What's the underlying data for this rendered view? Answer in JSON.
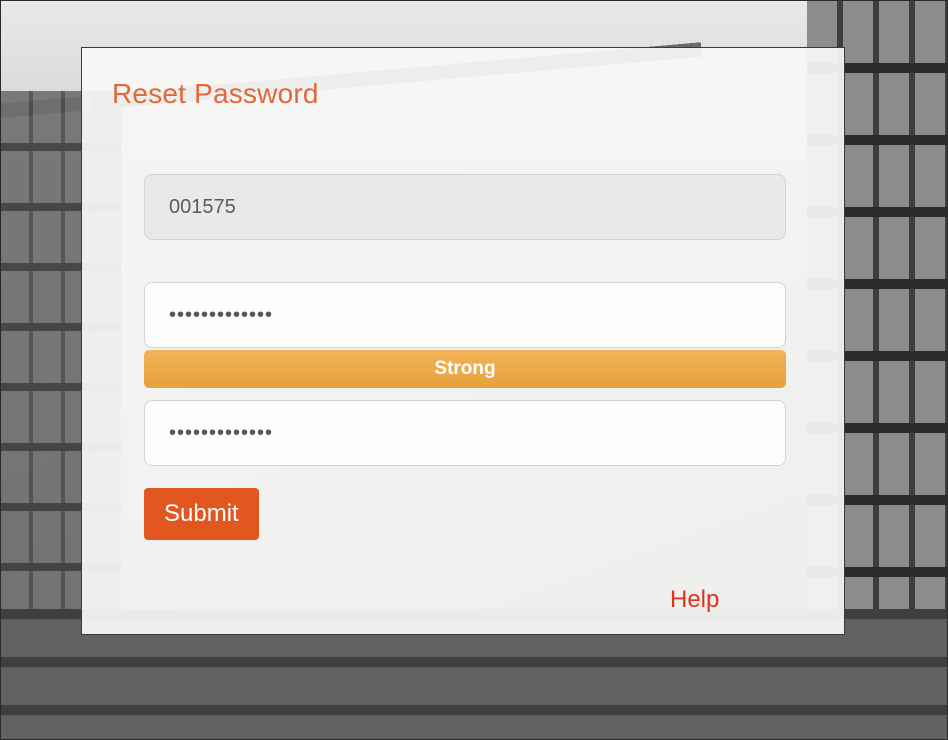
{
  "page": {
    "title": "Reset Password"
  },
  "form": {
    "user_id": {
      "value": "001575"
    },
    "new_password": {
      "value": "•••••••••••••"
    },
    "password_strength": {
      "label": "Strong"
    },
    "confirm_password": {
      "value": "•••••••••••••"
    },
    "submit_label": "Submit"
  },
  "footer": {
    "help_label": "Help"
  },
  "colors": {
    "accent": "#e2673a",
    "button": "#e2571f",
    "strength_strong": "#e6a13c",
    "help_link": "#e2331f"
  },
  "icons": {
    "background": "building-photo"
  }
}
